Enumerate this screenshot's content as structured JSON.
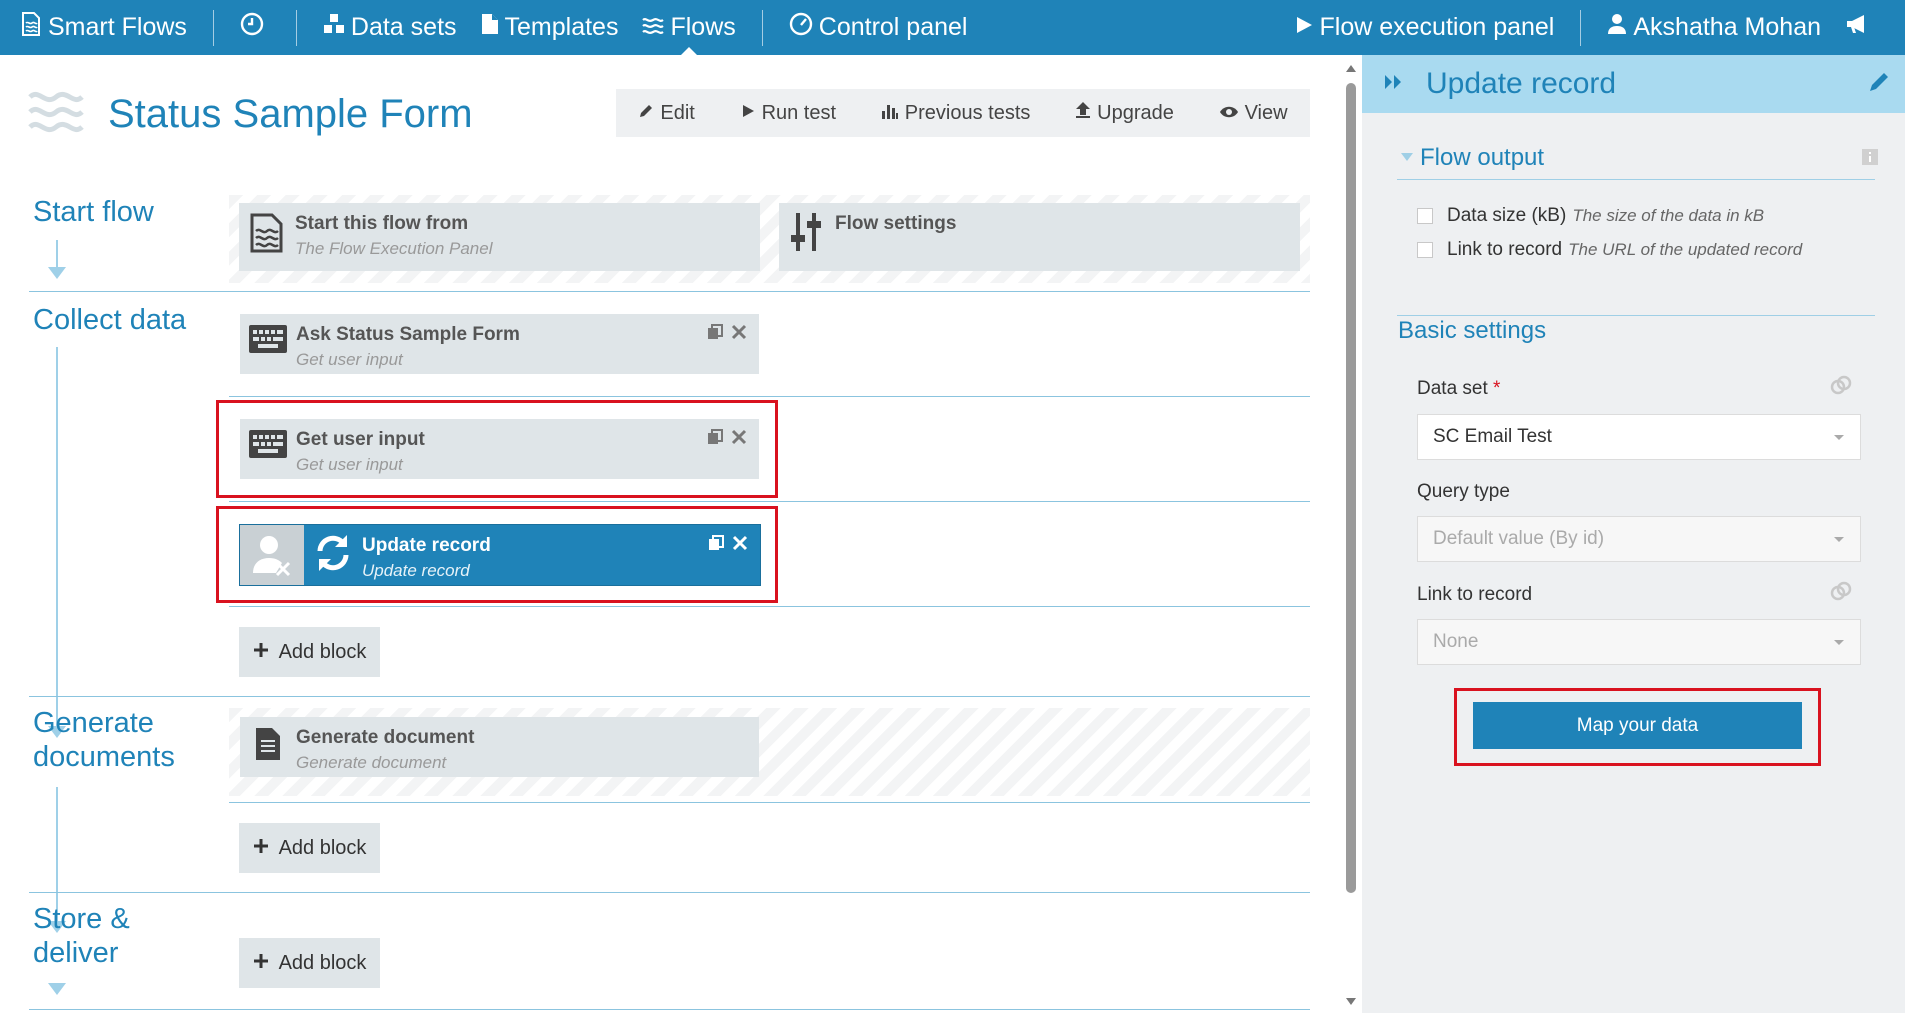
{
  "nav": {
    "brand": "Smart Flows",
    "datasets": "Data sets",
    "templates": "Templates",
    "flows": "Flows",
    "control_panel": "Control panel",
    "flow_execution_panel": "Flow execution panel",
    "user": "Akshatha Mohan"
  },
  "page": {
    "title": "Status Sample Form"
  },
  "toolbar": {
    "edit": "Edit",
    "run_test": "Run test",
    "previous_tests": "Previous tests",
    "upgrade": "Upgrade",
    "view": "View"
  },
  "sections": {
    "start": "Start flow",
    "collect": "Collect data",
    "generate": "Generate documents",
    "store": "Store & deliver"
  },
  "blocks": {
    "start_from": {
      "name": "Start this flow from",
      "sub": "The Flow Execution Panel"
    },
    "flow_settings": {
      "name": "Flow settings"
    },
    "ask_form": {
      "name": "Ask Status Sample Form",
      "sub": "Get user input"
    },
    "get_input": {
      "name": "Get user input",
      "sub": "Get user input"
    },
    "update_record": {
      "name": "Update record",
      "sub": "Update record"
    },
    "generate_doc": {
      "name": "Generate document",
      "sub": "Generate document"
    }
  },
  "add_block": "Add block",
  "panel": {
    "title": "Update record",
    "flow_output": {
      "title": "Flow output",
      "items": [
        {
          "label": "Data size (kB)",
          "desc": "The size of the data in kB"
        },
        {
          "label": "Link to record",
          "desc": "The URL of the updated record"
        }
      ]
    },
    "basic_settings": {
      "title": "Basic settings",
      "data_set_label": "Data set",
      "data_set_required": "*",
      "data_set_value": "SC Email Test",
      "query_type_label": "Query type",
      "query_type_value": "Default value (By id)",
      "link_label": "Link to record",
      "link_value": "None"
    },
    "map_button": "Map your data"
  },
  "colors": {
    "primary": "#1f83b8",
    "panel_header": "#a9daf0",
    "highlight": "#d9121f",
    "block": "#dfe5e8"
  }
}
